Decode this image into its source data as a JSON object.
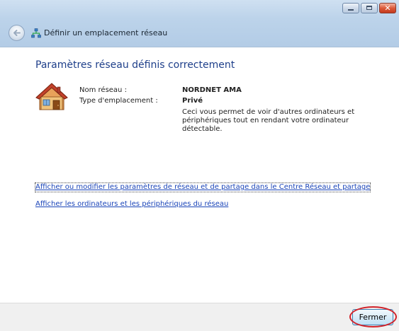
{
  "window": {
    "title": "Définir un emplacement réseau"
  },
  "content": {
    "heading": "Paramètres réseau définis correctement",
    "network_name_label": "Nom réseau :",
    "network_name_value": "NORDNET AMA",
    "location_type_label": "Type d'emplacement :",
    "location_type_value": "Privé",
    "description": "Ceci vous permet de voir d'autres ordinateurs et périphériques tout en rendant votre ordinateur détectable.",
    "link_network_center": "Afficher ou modifier les paramètres de réseau et de partage dans le Centre Réseau et partage",
    "link_view_computers": "Afficher les ordinateurs et les périphériques du réseau"
  },
  "footer": {
    "close_label": "Fermer"
  },
  "colors": {
    "heading": "#1e3f8a",
    "link": "#1a44b8",
    "highlight": "#d2232a"
  },
  "icons": {
    "back": "back-arrow-icon",
    "network": "network-icon",
    "house": "house-icon"
  }
}
